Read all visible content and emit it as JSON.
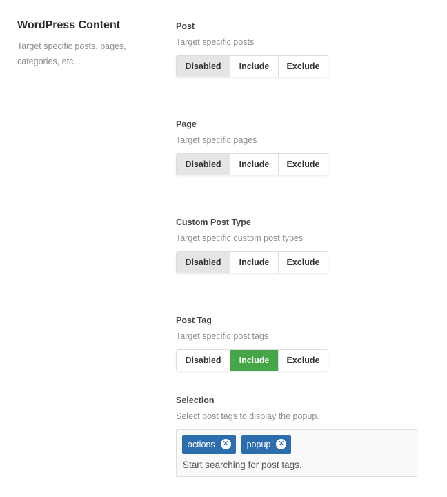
{
  "section": {
    "title": "WordPress Content",
    "description": "Target specific posts, pages, categories, etc..."
  },
  "options_labels": {
    "disabled": "Disabled",
    "include": "Include",
    "exclude": "Exclude"
  },
  "fields": [
    {
      "label": "Post",
      "help": "Target specific posts",
      "selected": "Disabled"
    },
    {
      "label": "Page",
      "help": "Target specific pages",
      "selected": "Disabled"
    },
    {
      "label": "Custom Post Type",
      "help": "Target specific custom post types",
      "selected": "Disabled"
    },
    {
      "label": "Post Tag",
      "help": "Target specific post tags",
      "selected": "Include"
    }
  ],
  "selection": {
    "label": "Selection",
    "help": "Select post tags to display the popup.",
    "tags": [
      "actions",
      "popup"
    ],
    "placeholder": "Start searching for post tags.",
    "remove_icon": "remove-circle-icon"
  },
  "colors": {
    "include_active": "#46a546",
    "disabled_active": "#e5e5e5",
    "tag_bg": "#2b6dad"
  }
}
